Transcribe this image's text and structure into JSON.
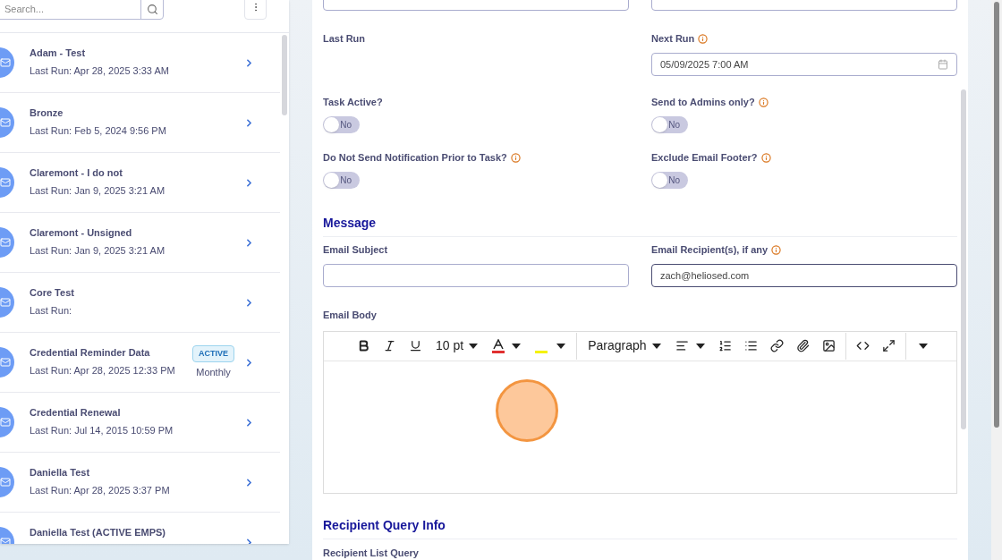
{
  "sidebar": {
    "search": {
      "placeholder": "Search..."
    },
    "items": [
      {
        "name": "Adam - Test",
        "last_run": "Last Run: Apr 28, 2025 3:33 AM"
      },
      {
        "name": "Bronze",
        "last_run": "Last Run: Feb 5, 2024 9:56 PM"
      },
      {
        "name": "Claremont - I do not",
        "last_run": "Last Run: Jan 9, 2025 3:21 AM"
      },
      {
        "name": "Claremont - Unsigned",
        "last_run": "Last Run: Jan 9, 2025 3:21 AM"
      },
      {
        "name": "Core Test",
        "last_run": "Last Run:"
      },
      {
        "name": "Credential Reminder Data",
        "last_run": "Last Run: Apr 28, 2025 12:33 PM",
        "badge": "ACTIVE",
        "frequency": "Monthly"
      },
      {
        "name": "Credential Renewal",
        "last_run": "Last Run: Jul 14, 2015 10:59 PM"
      },
      {
        "name": "Daniella Test",
        "last_run": "Last Run: Apr 28, 2025 3:37 PM"
      },
      {
        "name": "Daniella Test (ACTIVE EMPS)"
      }
    ]
  },
  "form": {
    "schedule": [
      {
        "label": "Last Run",
        "info": false
      },
      {
        "label": "Next Run",
        "info": true,
        "value": "05/09/2025 7:00 AM"
      }
    ],
    "toggles": [
      {
        "label": "Task Active?",
        "info": false,
        "on": false,
        "text": "No"
      },
      {
        "label": "Send to Admins only?",
        "info": true,
        "on": false,
        "text": "No"
      },
      {
        "label": "Do Not Send Notification Prior to Task?",
        "info": true,
        "on": false,
        "text": "No"
      },
      {
        "label": "Exclude Email Footer?",
        "info": true,
        "on": false,
        "text": "No"
      }
    ],
    "message": {
      "title": "Message",
      "fields": [
        {
          "label": "Email Subject",
          "info": false
        },
        {
          "label": "Email Recipient(s), if any",
          "info": true,
          "value": "zach@heliosed.com"
        }
      ],
      "body_label": "Email Body",
      "toolbar": [
        {
          "kind": "bold"
        },
        {
          "kind": "italic"
        },
        {
          "kind": "underline"
        },
        {
          "kind": "dropdown",
          "text": "10 pt"
        },
        {
          "kind": "font-color"
        },
        {
          "kind": "highlight"
        },
        {
          "kind": "sep"
        },
        {
          "kind": "dropdown",
          "text": "Paragraph"
        },
        {
          "kind": "align"
        },
        {
          "kind": "numbered"
        },
        {
          "kind": "bullets"
        },
        {
          "kind": "link"
        },
        {
          "kind": "attach"
        },
        {
          "kind": "image"
        },
        {
          "kind": "sep"
        },
        {
          "kind": "code"
        },
        {
          "kind": "fullscreen"
        },
        {
          "kind": "sep"
        },
        {
          "kind": "more"
        }
      ]
    },
    "recipient_query": {
      "title": "Recipient Query Info",
      "label": "Recipient List Query"
    }
  }
}
